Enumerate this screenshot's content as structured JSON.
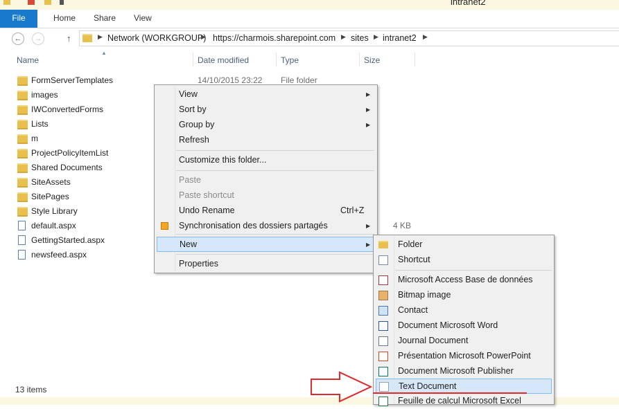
{
  "window": {
    "title": "intranet2"
  },
  "ribbon": {
    "tabs": [
      "File",
      "Home",
      "Share",
      "View"
    ]
  },
  "address": {
    "crumbs": [
      "Network (WORKGROUP)",
      "https://charmois.sharepoint.com",
      "sites",
      "intranet2"
    ]
  },
  "columns": {
    "name": "Name",
    "date": "Date modified",
    "type": "Type",
    "size": "Size"
  },
  "files": [
    {
      "name": "FormServerTemplates",
      "date": "14/10/2015 23:22",
      "type": "File folder",
      "size": "",
      "kind": "folder"
    },
    {
      "name": "images",
      "date": "",
      "type": "",
      "size": "",
      "kind": "folder"
    },
    {
      "name": "IWConvertedForms",
      "date": "",
      "type": "",
      "size": "",
      "kind": "folder"
    },
    {
      "name": "Lists",
      "date": "",
      "type": "",
      "size": "",
      "kind": "folder"
    },
    {
      "name": "m",
      "date": "",
      "type": "",
      "size": "",
      "kind": "folder"
    },
    {
      "name": "ProjectPolicyItemList",
      "date": "",
      "type": "",
      "size": "",
      "kind": "folder"
    },
    {
      "name": "Shared Documents",
      "date": "",
      "type": "",
      "size": "",
      "kind": "folder"
    },
    {
      "name": "SiteAssets",
      "date": "",
      "type": "",
      "size": "",
      "kind": "folder"
    },
    {
      "name": "SitePages",
      "date": "",
      "type": "",
      "size": "",
      "kind": "folder"
    },
    {
      "name": "Style Library",
      "date": "",
      "type": "",
      "size": "",
      "kind": "folder"
    },
    {
      "name": "default.aspx",
      "date": "",
      "type": "",
      "size": "4 KB",
      "kind": "doc"
    },
    {
      "name": "GettingStarted.aspx",
      "date": "",
      "type": "",
      "size": "",
      "kind": "doc"
    },
    {
      "name": "newsfeed.aspx",
      "date": "",
      "type": "",
      "size": "",
      "kind": "doc"
    }
  ],
  "status": {
    "items_count": "13 items"
  },
  "context_menu": {
    "items": [
      {
        "label": "View",
        "submenu": true
      },
      {
        "label": "Sort by",
        "submenu": true
      },
      {
        "label": "Group by",
        "submenu": true
      },
      {
        "label": "Refresh"
      },
      {
        "label": "Customize this folder..."
      },
      {
        "label": "Paste",
        "disabled": true
      },
      {
        "label": "Paste shortcut",
        "disabled": true
      },
      {
        "label": "Undo Rename",
        "shortcut": "Ctrl+Z"
      },
      {
        "label": "Synchronisation des dossiers partagés",
        "submenu": true,
        "icon": "sync-icon"
      },
      {
        "label": "New",
        "submenu": true,
        "highlighted": true
      },
      {
        "label": "Properties"
      }
    ]
  },
  "new_submenu": {
    "items": [
      {
        "label": "Folder",
        "icon": "folder-icon"
      },
      {
        "label": "Shortcut",
        "icon": "shortcut-icon"
      },
      {
        "label": "Microsoft Access Base de données",
        "icon": "access-icon"
      },
      {
        "label": "Bitmap image",
        "icon": "bitmap-icon"
      },
      {
        "label": "Contact",
        "icon": "contact-icon"
      },
      {
        "label": "Document Microsoft Word",
        "icon": "word-icon"
      },
      {
        "label": "Journal Document",
        "icon": "journal-icon"
      },
      {
        "label": "Présentation Microsoft PowerPoint",
        "icon": "powerpoint-icon"
      },
      {
        "label": "Document Microsoft Publisher",
        "icon": "publisher-icon"
      },
      {
        "label": "Text Document",
        "icon": "text-document-icon",
        "highlighted": true
      },
      {
        "label": "Feuille de calcul Microsoft Excel",
        "icon": "excel-icon"
      }
    ]
  },
  "colors": {
    "file_tab": "#1979ca",
    "menu_highlight": "#d5e7f8",
    "annotation": "#e0282e"
  }
}
